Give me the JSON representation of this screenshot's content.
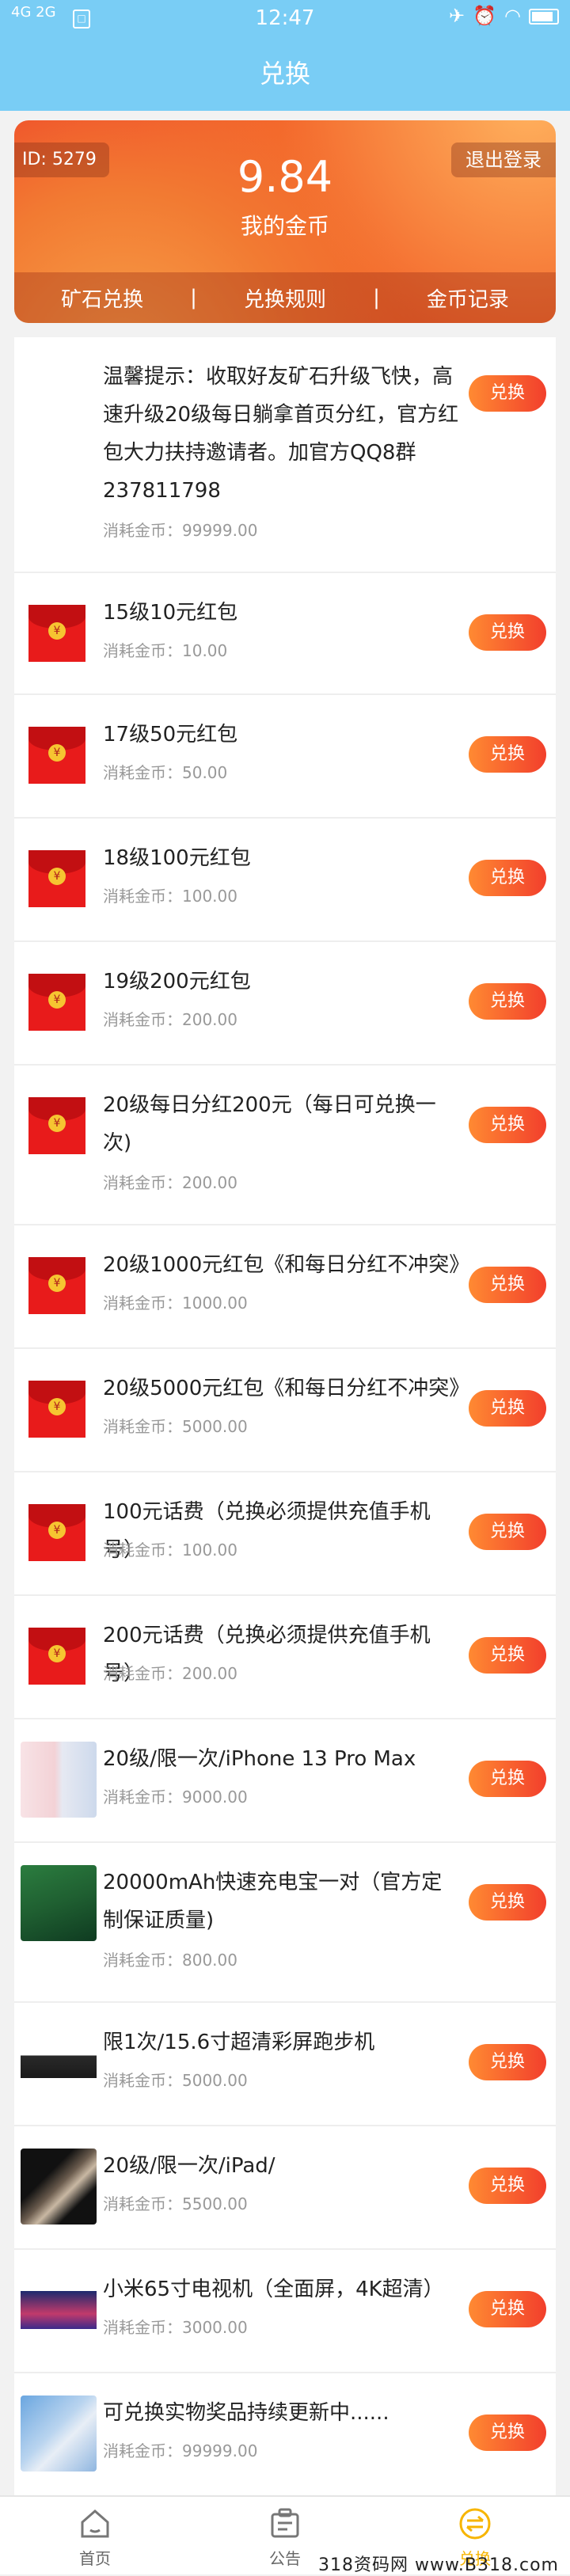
{
  "status": {
    "network": "4G 2G",
    "time": "12:47"
  },
  "title": "兑换",
  "banner": {
    "id": "ID: 5279",
    "coins": "9.84",
    "coins_label": "我的金币",
    "logout": "退出登录",
    "menu": [
      "矿石兑换",
      "兑换规则",
      "金币记录"
    ]
  },
  "items": [
    {
      "name": "温馨提示：收取好友矿石升级飞快，高速升级20级每日躺拿首页分红，官方红包大力扶持邀请者。加官方QQ8群237811798",
      "cost": "消耗金币：99999.00",
      "btn": "兑换",
      "thumb": "none"
    },
    {
      "name": "15级10元红包",
      "cost": "消耗金币：10.00",
      "btn": "兑换",
      "thumb": "red-packet-icon"
    },
    {
      "name": "17级50元红包",
      "cost": "消耗金币：50.00",
      "btn": "兑换",
      "thumb": "red-packet-icon"
    },
    {
      "name": "18级100元红包",
      "cost": "消耗金币：100.00",
      "btn": "兑换",
      "thumb": "red-packet-icon"
    },
    {
      "name": "19级200元红包",
      "cost": "消耗金币：200.00",
      "btn": "兑换",
      "thumb": "red-packet-icon"
    },
    {
      "name": "20级每日分红200元（每日可兑换一次)",
      "cost": "消耗金币：200.00",
      "btn": "兑换",
      "thumb": "red-packet-icon"
    },
    {
      "name": "20级1000元红包《和每日分红不冲突》",
      "cost": "消耗金币：1000.00",
      "btn": "兑换",
      "thumb": "red-packet-icon"
    },
    {
      "name": "20级5000元红包《和每日分红不冲突》",
      "cost": "消耗金币：5000.00",
      "btn": "兑换",
      "thumb": "red-packet-icon"
    },
    {
      "name": "100元话费（兑换必须提供充值手机号）",
      "cost": "消耗金币：100.00",
      "btn": "兑换",
      "thumb": "red-packet-icon"
    },
    {
      "name": "200元话费（兑换必须提供充值手机号）",
      "cost": "消耗金币：200.00",
      "btn": "兑换",
      "thumb": "red-packet-icon"
    },
    {
      "name": "20级/限一次/iPhone 13 Pro Max",
      "cost": "消耗金币：9000.00",
      "btn": "兑换",
      "thumb": "iphone-image"
    },
    {
      "name": "20000mAh快速充电宝一对（官方定制保证质量)",
      "cost": "消耗金币：800.00",
      "btn": "兑换",
      "thumb": "power-bank-image"
    },
    {
      "name": "限1次/15.6寸超清彩屏跑步机",
      "cost": "消耗金币：5000.00",
      "btn": "兑换",
      "thumb": "treadmill-image"
    },
    {
      "name": "20级/限一次/iPad/",
      "cost": "消耗金币：5500.00",
      "btn": "兑换",
      "thumb": "ipad-image"
    },
    {
      "name": "小米65寸电视机（全面屏，4K超清）",
      "cost": "消耗金币：3000.00",
      "btn": "兑换",
      "thumb": "tv-image"
    },
    {
      "name": "可兑换实物奖品持续更新中......",
      "cost": "消耗金币：99999.00",
      "btn": "兑换",
      "thumb": "prize-image"
    }
  ],
  "nav": [
    {
      "label": "首页",
      "icon": "home-icon"
    },
    {
      "label": "公告",
      "icon": "notice-icon"
    },
    {
      "label": "兑换",
      "icon": "exchange-icon"
    }
  ],
  "watermark": "318资码网 www.B318.com"
}
